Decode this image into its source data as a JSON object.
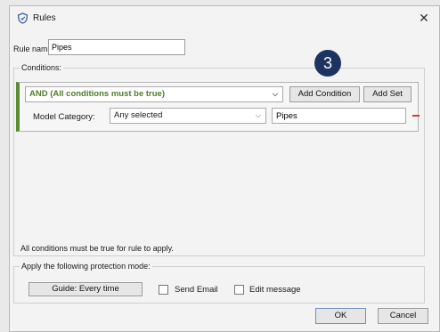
{
  "window": {
    "title": "Rules",
    "close_glyph": "✕"
  },
  "rule_name": {
    "label": "Rule name:",
    "value": "Pipes"
  },
  "conditions": {
    "label": "Conditions:",
    "set_mode": "AND (All conditions must be true)",
    "add_condition_label": "Add Condition",
    "add_set_label": "Add Set",
    "rows": [
      {
        "field_label": "Model Category:",
        "operator": "Any selected",
        "value": "Pipes"
      }
    ],
    "info": "All conditions must be true for rule to apply."
  },
  "annotation": {
    "number": "3"
  },
  "protection": {
    "label": "Apply the following protection mode:",
    "mode_button": "Guide: Every time",
    "send_email_label": "Send Email",
    "edit_message_label": "Edit message"
  },
  "footer": {
    "ok_label": "OK",
    "cancel_label": "Cancel"
  },
  "colors": {
    "accent_green": "#5b8b33",
    "badge": "#1d3460",
    "remove": "#d23a3a"
  },
  "icons": [
    "rules-app-icon",
    "close-icon",
    "chevron-down-icon",
    "remove-icon",
    "checkbox-icon"
  ]
}
